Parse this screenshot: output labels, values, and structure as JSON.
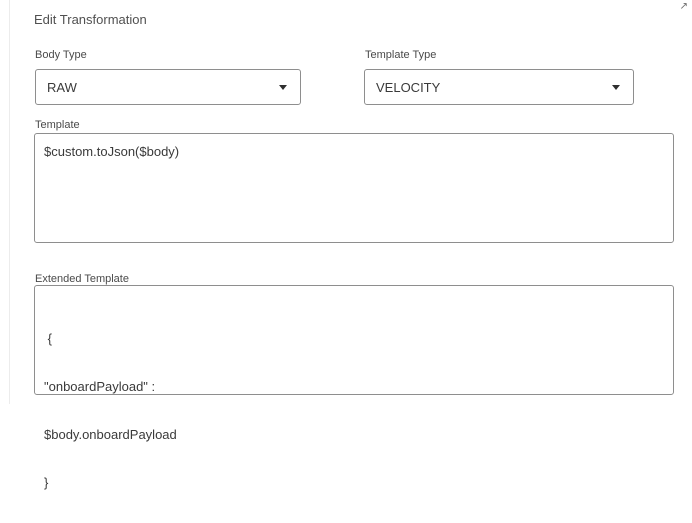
{
  "dialog": {
    "title": "Edit Transformation"
  },
  "body_type": {
    "label": "Body Type",
    "value": "RAW"
  },
  "template_type": {
    "label": "Template Type",
    "value": "VELOCITY"
  },
  "template": {
    "label": "Template",
    "value": "$custom.toJson($body)"
  },
  "extended_template": {
    "label": "Extended Template",
    "lines": [
      " {",
      "\"onboardPayload\" :",
      "$body.onboardPayload",
      "}"
    ]
  },
  "icons": {
    "dropdown_caret": "chevron-down-icon",
    "corner": "resize-corner-icon"
  },
  "colors": {
    "field_border": "#8e8e8e",
    "text": "#3a3a3a",
    "background": "#ffffff"
  }
}
